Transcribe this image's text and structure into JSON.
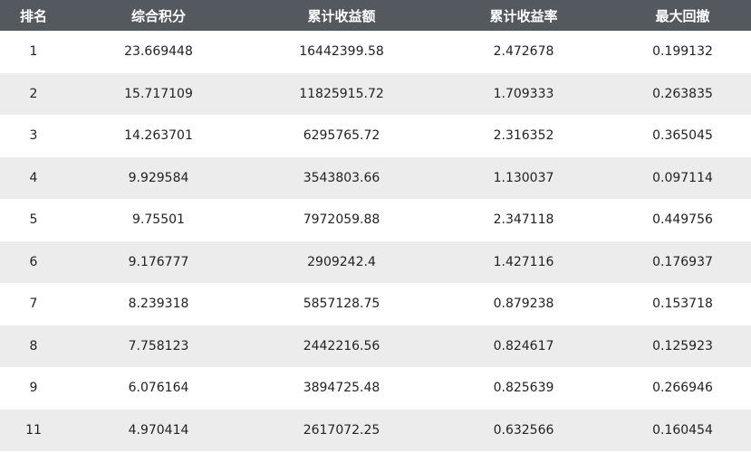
{
  "table": {
    "headers": [
      "排名",
      "综合积分",
      "累计收益额",
      "累计收益率",
      "最大回撤"
    ],
    "rows": [
      [
        "1",
        "23.669448",
        "16442399.58",
        "2.472678",
        "0.199132"
      ],
      [
        "2",
        "15.717109",
        "11825915.72",
        "1.709333",
        "0.263835"
      ],
      [
        "3",
        "14.263701",
        "6295765.72",
        "2.316352",
        "0.365045"
      ],
      [
        "4",
        "9.929584",
        "3543803.66",
        "1.130037",
        "0.097114"
      ],
      [
        "5",
        "9.75501",
        "7972059.88",
        "2.347118",
        "0.449756"
      ],
      [
        "6",
        "9.176777",
        "2909242.4",
        "1.427116",
        "0.176937"
      ],
      [
        "7",
        "8.239318",
        "5857128.75",
        "0.879238",
        "0.153718"
      ],
      [
        "8",
        "7.758123",
        "2442216.56",
        "0.824617",
        "0.125923"
      ],
      [
        "9",
        "6.076164",
        "3894725.48",
        "0.825639",
        "0.266946"
      ],
      [
        "11",
        "4.970414",
        "2617072.25",
        "0.632566",
        "0.160454"
      ]
    ]
  },
  "colors": {
    "header_bg": "#53595e",
    "header_text": "#ffffff",
    "stripe_bg": "#ececec",
    "text": "#222222"
  }
}
